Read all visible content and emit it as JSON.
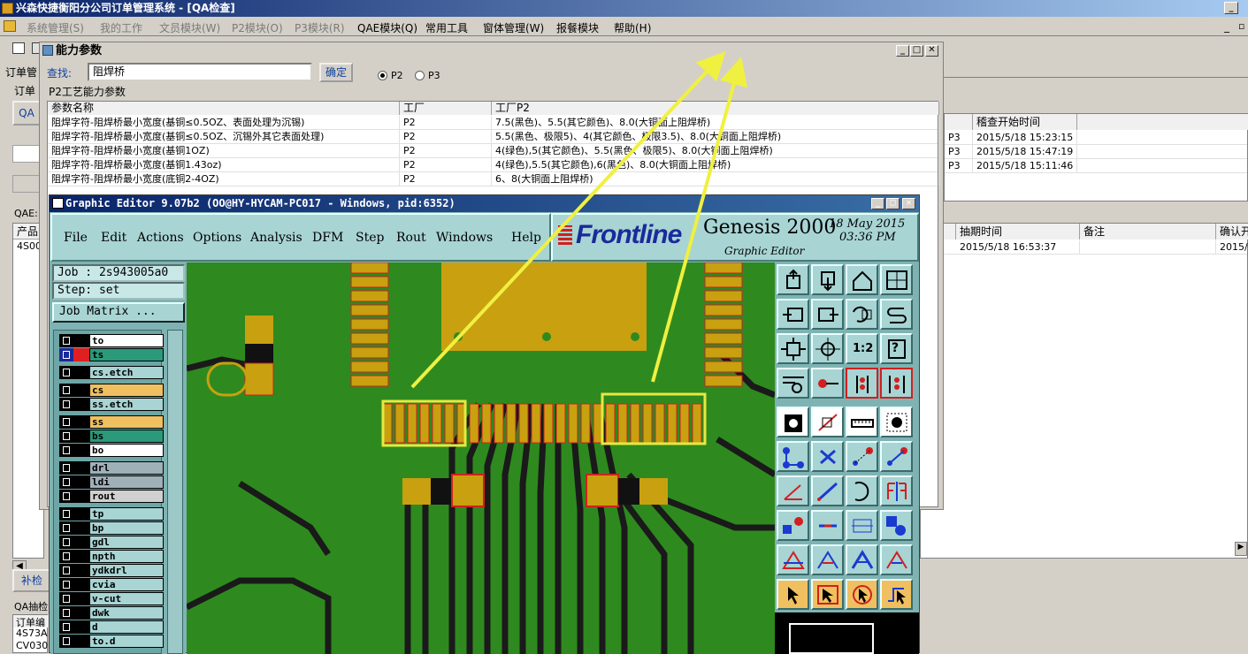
{
  "main_window": {
    "title": "兴森快捷衡阳分公司订单管理系统 - [QA检查]",
    "controls": [
      "_",
      "▫"
    ]
  },
  "menubar": [
    {
      "label": "系统管理(S)",
      "enabled": false
    },
    {
      "label": "我的工作",
      "enabled": false
    },
    {
      "label": "文员模块(W)",
      "enabled": false
    },
    {
      "label": "P2模块(O)",
      "enabled": false
    },
    {
      "label": "P3模块(R)",
      "enabled": false
    },
    {
      "label": "QAE模块(Q)",
      "enabled": true
    },
    {
      "label": "常用工具",
      "enabled": true
    },
    {
      "label": "窗体管理(W)",
      "enabled": true
    },
    {
      "label": "报餐模块",
      "enabled": true
    },
    {
      "label": "帮助(H)",
      "enabled": true
    }
  ],
  "bg_form": {
    "left_labels": [
      "订单管",
      "订单",
      "QA",
      "QAE:",
      "产品",
      "4S00",
      "补检",
      "QA抽检",
      "订单编",
      "4S73A",
      "CV030"
    ],
    "top_grid": {
      "headers": [
        "稽查开始时间"
      ],
      "rows": [
        {
          "col1": "P3",
          "time": "2015/5/18 15:23:15"
        },
        {
          "col1": "P3",
          "time": "2015/5/18 15:47:19"
        },
        {
          "col1": "P3",
          "time": "2015/5/18 15:11:46"
        }
      ]
    },
    "mid_grid": {
      "headers": [
        "抽期时间",
        "备注",
        "确认开"
      ],
      "row": {
        "time": "2015/5/18 16:53:37",
        "confirm": "2015/5"
      }
    }
  },
  "capability_window": {
    "title": "能力参数",
    "search_label": "查找:",
    "search_value": "阻焊桥",
    "confirm_button": "确定",
    "radio_p2": "P2",
    "radio_p3": "P3",
    "radio_selected": "P2",
    "group_label": "P2工艺能力参数",
    "columns": [
      "参数名称",
      "工厂",
      "工厂P2"
    ],
    "rows": [
      {
        "name": "阻焊字符-阻焊桥最小宽度(基铜≤0.5OZ、表面处理为沉锡)",
        "factory": "P2",
        "value": "7.5(黑色)、5.5(其它颜色)、8.0(大铜面上阻焊桥)"
      },
      {
        "name": "阻焊字符-阻焊桥最小宽度(基铜≤0.5OZ、沉锡外其它表面处理)",
        "factory": "P2",
        "value": "5.5(黑色、极限5)、4(其它颜色、极限3.5)、8.0(大铜面上阻焊桥)"
      },
      {
        "name": "阻焊字符-阻焊桥最小宽度(基铜1OZ)",
        "factory": "P2",
        "value": "4(绿色),5(其它颜色)、5.5(黑色、极限5)、8.0(大铜面上阻焊桥)"
      },
      {
        "name": "阻焊字符-阻焊桥最小宽度(基铜1.43oz)",
        "factory": "P2",
        "value": "4(绿色),5.5(其它颜色),6(黑色)、8.0(大铜面上阻焊桥)"
      },
      {
        "name": "阻焊字符-阻焊桥最小宽度(底铜2-4OZ)",
        "factory": "P2",
        "value": "6、8(大铜面上阻焊桥)"
      }
    ]
  },
  "graphic_editor": {
    "title": "Graphic Editor 9.07b2 (OO@HY-HYCAM-PC017 - Windows, pid:6352)",
    "menu": [
      "File",
      "Edit",
      "Actions",
      "Options",
      "Analysis",
      "DFM",
      "Step",
      "Rout",
      "Windows",
      "Help"
    ],
    "logo_text": "Frontline",
    "product": "Genesis 2000",
    "product_sub": "Graphic Editor",
    "date": "18 May 2015",
    "time": "03:36 PM",
    "job": "Job : 2s943005a0",
    "step": "Step: set",
    "job_matrix": "Job Matrix ...",
    "layers": [
      {
        "name": "to",
        "color": "#ffffff",
        "swatch": "#000000"
      },
      {
        "name": "ts",
        "color": "#2a9a7a",
        "swatch": "#e02020",
        "active": true
      },
      {
        "name": "cs.etch",
        "color": "#a8d4d4",
        "swatch": "#000000"
      },
      {
        "name": "cs",
        "color": "#f0c060",
        "swatch": "#000000"
      },
      {
        "name": "ss.etch",
        "color": "#a8d4d4",
        "swatch": "#000000"
      },
      {
        "name": "ss",
        "color": "#f0c060",
        "swatch": "#000000"
      },
      {
        "name": "bs",
        "color": "#2a9a7a",
        "swatch": "#000000"
      },
      {
        "name": "bo",
        "color": "#ffffff",
        "swatch": "#000000"
      },
      {
        "name": "drl",
        "color": "#a0b0b8",
        "swatch": "#000000"
      },
      {
        "name": "ldi",
        "color": "#a0b0b8",
        "swatch": "#000000"
      },
      {
        "name": "rout",
        "color": "#d0d0d0",
        "swatch": "#000000"
      },
      {
        "name": "tp",
        "color": "#a8d4d4",
        "swatch": "#000000"
      },
      {
        "name": "bp",
        "color": "#a8d4d4",
        "swatch": "#000000"
      },
      {
        "name": "gdl",
        "color": "#a8d4d4",
        "swatch": "#000000"
      },
      {
        "name": "npth",
        "color": "#a8d4d4",
        "swatch": "#000000"
      },
      {
        "name": "ydkdrl",
        "color": "#a8d4d4",
        "swatch": "#000000"
      },
      {
        "name": "cvia",
        "color": "#a8d4d4",
        "swatch": "#000000"
      },
      {
        "name": "v-cut",
        "color": "#a8d4d4",
        "swatch": "#000000"
      },
      {
        "name": "dwk",
        "color": "#a8d4d4",
        "swatch": "#000000"
      },
      {
        "name": "d",
        "color": "#a8d4d4",
        "swatch": "#000000"
      },
      {
        "name": "to.d",
        "color": "#a8d4d4",
        "swatch": "#000000"
      }
    ],
    "tool_labels": {
      "ratio": "1:2",
      "help": "?"
    }
  }
}
